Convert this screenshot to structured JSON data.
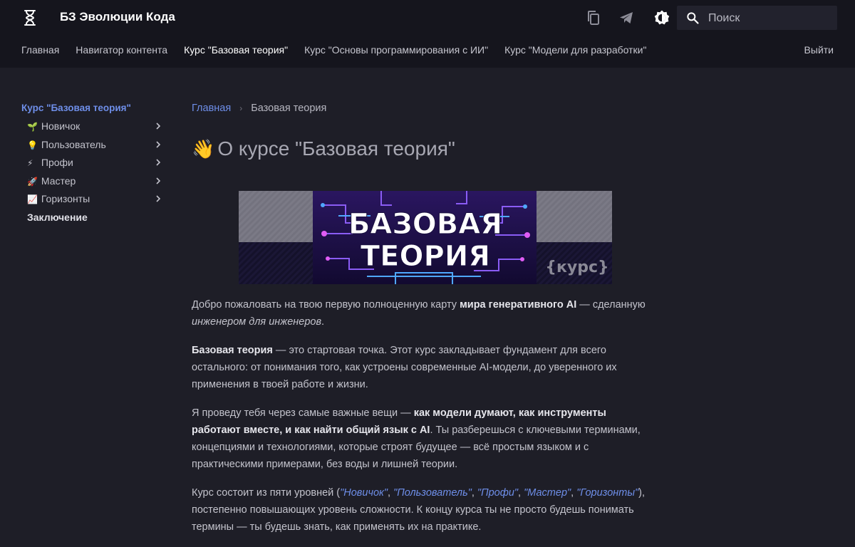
{
  "header": {
    "site_title": "БЗ Эволюции Кода",
    "search_placeholder": "Поиск",
    "colors": {
      "background": "#15151d",
      "accent": "#6e8ee8"
    },
    "icons": [
      "logo-icon",
      "copy-icon",
      "telegram-icon",
      "theme-toggle-icon",
      "search-icon"
    ]
  },
  "tabs": [
    {
      "label": "Главная"
    },
    {
      "label": "Навигатор контента"
    },
    {
      "label": "Курс \"Базовая теория\""
    },
    {
      "label": "Курс \"Основы программирования с ИИ\""
    },
    {
      "label": "Курс \"Модели для разработки\""
    }
  ],
  "logout_label": "Выйти",
  "sidebar": {
    "title": "Курс \"Базовая теория\"",
    "items": [
      {
        "emoji": "🌱",
        "label": "Новичок"
      },
      {
        "emoji": "💡",
        "label": "Пользователь"
      },
      {
        "emoji": "⚡",
        "label": "Профи"
      },
      {
        "emoji": "🚀",
        "label": "Мастер"
      },
      {
        "emoji": "📈",
        "label": "Горизонты"
      }
    ],
    "conclusion": "Заключение"
  },
  "breadcrumb": {
    "home": "Главная",
    "separator": "›",
    "current": "Базовая теория"
  },
  "page": {
    "title_emoji": "👋",
    "title": "О курсе \"Базовая теория\""
  },
  "banner": {
    "line1": "БАЗОВАЯ",
    "line2": "ТЕОРИЯ",
    "tag": "{курс}"
  },
  "content": {
    "p1_a": "Добро пожаловать на твою первую полноценную карту ",
    "p1_b": "мира генеративного AI",
    "p1_c": " — сделанную ",
    "p1_d": "инженером для инженеров",
    "p1_e": ".",
    "p2_a": "Базовая теория",
    "p2_b": " — это стартовая точка. Этот курс закладывает фундамент для всего остального: от понимания того, как устроены современные AI-модели, до уверенного их применения в твоей работе и жизни.",
    "p3_a": "Я проведу тебя через самые важные вещи — ",
    "p3_b": "как модели думают, как инструменты работают вместе, и как найти общий язык с AI",
    "p3_c": ". Ты разберешься с ключевыми терминами, концепциями и технологиями, которые строят будущее — всё простым языком и с практическими примерами, без воды и лишней теории.",
    "p4_a": "Курс состоит из пяти уровней (",
    "levels": [
      "\"Новичок\"",
      "\"Пользователь\"",
      "\"Профи\"",
      "\"Мастер\"",
      "\"Горизонты\""
    ],
    "p4_b": "), постепенно повышающих уровень сложности. К концу курса ты не просто будешь понимать термины — ты будешь знать, как применять их на практике."
  }
}
